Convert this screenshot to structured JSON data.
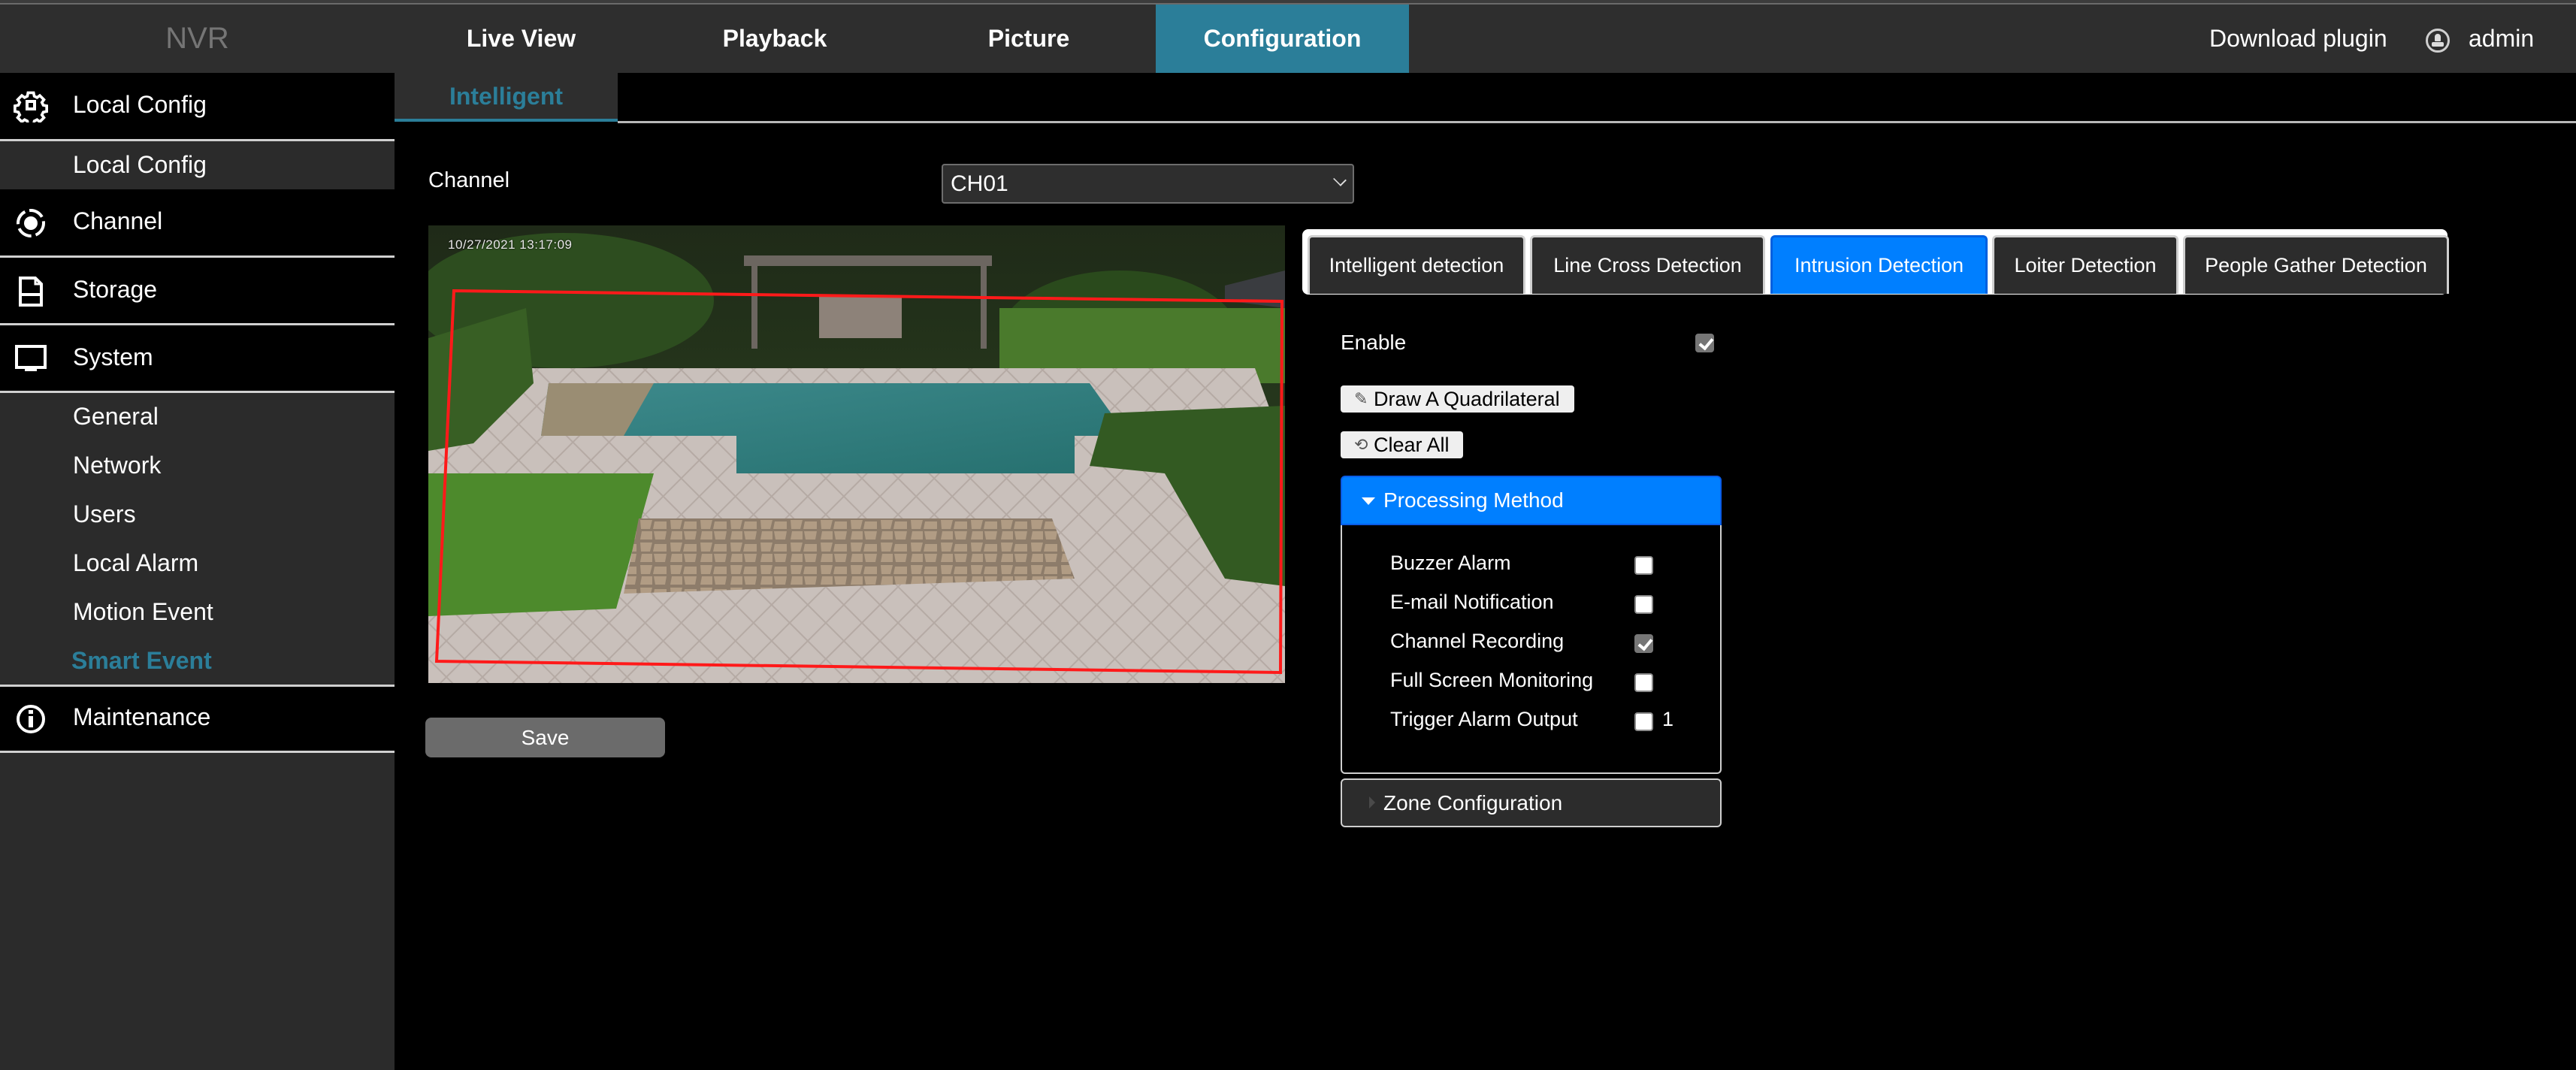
{
  "header": {
    "brand": "NVR",
    "nav": [
      {
        "label": "Live View",
        "active": false
      },
      {
        "label": "Playback",
        "active": false
      },
      {
        "label": "Picture",
        "active": false
      },
      {
        "label": "Configuration",
        "active": true
      }
    ],
    "download_plugin": "Download plugin",
    "user": {
      "icon": "user-circle-icon",
      "name": "admin"
    }
  },
  "sidebar": {
    "sections": [
      {
        "label": "Local Config",
        "icon": "gear-icon",
        "children": [
          {
            "label": "Local Config",
            "active": false
          }
        ]
      },
      {
        "label": "Channel",
        "icon": "camera-lens-icon",
        "children": []
      },
      {
        "label": "Storage",
        "icon": "storage-icon",
        "children": []
      },
      {
        "label": "System",
        "icon": "monitor-icon",
        "children": [
          {
            "label": "General",
            "active": false
          },
          {
            "label": "Network",
            "active": false
          },
          {
            "label": "Users",
            "active": false
          },
          {
            "label": "Local Alarm",
            "active": false
          },
          {
            "label": "Motion Event",
            "active": false
          },
          {
            "label": "Smart Event",
            "active": true
          }
        ]
      },
      {
        "label": "Maintenance",
        "icon": "info-icon",
        "children": []
      }
    ]
  },
  "main": {
    "subtab": "Intelligent",
    "channel": {
      "label": "Channel",
      "selected": "CH01"
    },
    "video": {
      "timestamp": "10/27/2021  13:17:09",
      "region_color": "#ff1a1a"
    },
    "save_label": "Save",
    "detection_tabs": [
      {
        "label": "Intelligent detection",
        "active": false
      },
      {
        "label": "Line Cross Detection",
        "active": false
      },
      {
        "label": "Intrusion Detection",
        "active": true
      },
      {
        "label": "Loiter Detection",
        "active": false
      },
      {
        "label": "People Gather Detection",
        "active": false
      }
    ],
    "enable": {
      "label": "Enable",
      "checked": true
    },
    "draw_button": {
      "label": "Draw A Quadrilateral",
      "icon": "pencil-icon"
    },
    "clear_button": {
      "label": "Clear All",
      "icon": "refresh-icon"
    },
    "processing_method": {
      "title": "Processing Method",
      "expanded": true,
      "options": [
        {
          "label": "Buzzer Alarm",
          "checked": false
        },
        {
          "label": "E-mail Notification",
          "checked": false
        },
        {
          "label": "Channel Recording",
          "checked": true
        },
        {
          "label": "Full Screen Monitoring",
          "checked": false
        },
        {
          "label": "Trigger Alarm Output",
          "checked": false,
          "suffix": "1"
        }
      ]
    },
    "zone_configuration": {
      "title": "Zone Configuration",
      "expanded": false
    }
  },
  "colors": {
    "accent": "#2b7e99",
    "active_tab": "#007fff",
    "header_bg": "#2e2e2e",
    "sidebar_bg": "#2b2b2b"
  }
}
